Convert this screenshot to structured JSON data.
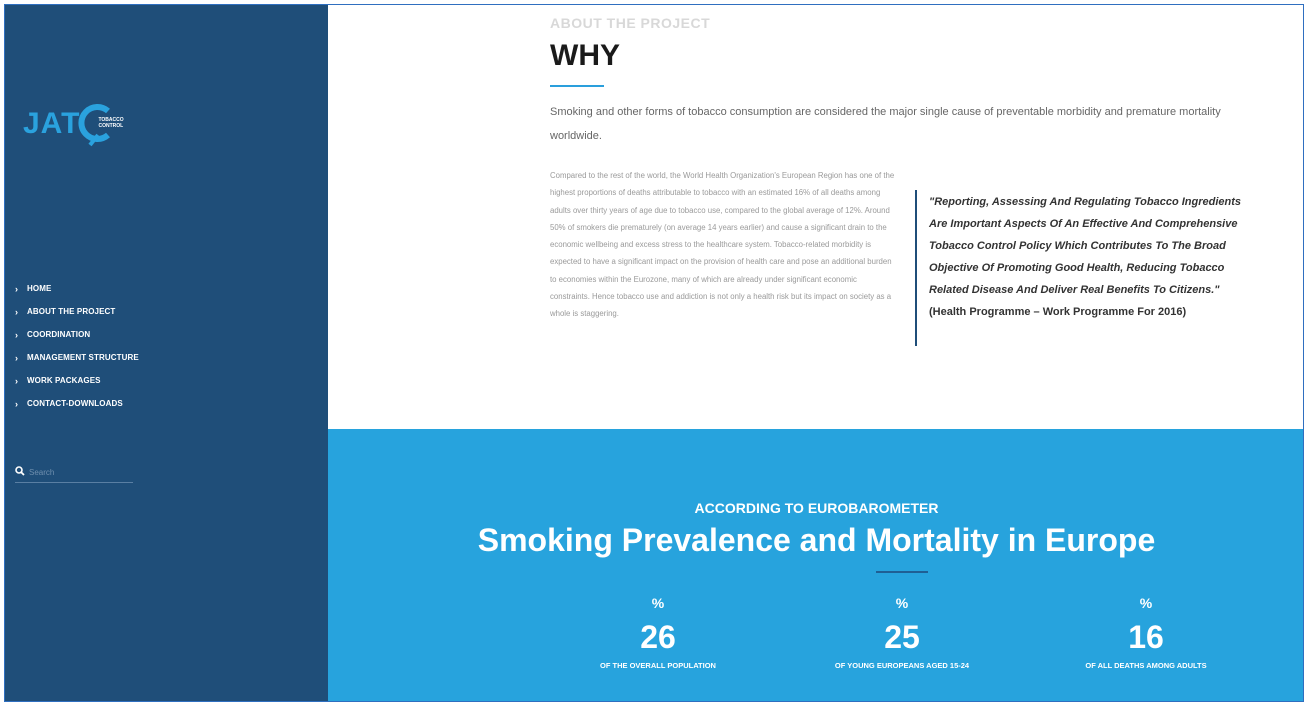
{
  "sidebar": {
    "logo_text": "JAT",
    "logo_sub": "TOBACCO CONTROL",
    "nav": [
      {
        "label": "HOME"
      },
      {
        "label": "ABOUT THE PROJECT"
      },
      {
        "label": "COORDINATION"
      },
      {
        "label": "MANAGEMENT STRUCTURE"
      },
      {
        "label": "WORK PACKAGES"
      },
      {
        "label": "CONTACT-DOWNLOADS"
      }
    ],
    "search_placeholder": "Search"
  },
  "about": {
    "eyebrow": "ABOUT THE PROJECT",
    "title": "WHY",
    "lead": "Smoking and other forms of tobacco consumption are considered the major single cause of preventable morbidity and premature mortality worldwide.",
    "body": "Compared to the rest of the world, the World Health Organization's European Region has one of the highest proportions of deaths attributable to tobacco with an estimated 16% of all deaths among adults over thirty years of age due to tobacco use, compared to the global average of 12%. Around 50% of smokers die prematurely (on average 14 years earlier) and cause a significant drain to the economic wellbeing and excess stress to the healthcare system. Tobacco-related morbidity is expected to have a significant impact on the provision of health care and pose an additional burden to economies within the Eurozone, many of which are already under significant economic constraints. Hence tobacco use and addiction is not only a health risk but its impact on society as a whole is staggering.",
    "quote": "\"Reporting, Assessing And Regulating Tobacco Ingredients Are Important Aspects Of An Effective And Comprehensive Tobacco Control Policy Which Contributes To The Broad Objective Of Promoting Good Health, Reducing Tobacco Related Disease And Deliver Real Benefits To Citizens.\"",
    "quote_source": "(Health Programme – Work Programme For 2016)"
  },
  "stats": {
    "eyebrow": "ACCORDING TO EUROBAROMETER",
    "title": "Smoking Prevalence and Mortality in Europe",
    "items": [
      {
        "pct": "%",
        "value": "26",
        "label": "OF THE OVERALL POPULATION"
      },
      {
        "pct": "%",
        "value": "25",
        "label": "OF YOUNG EUROPEANS AGED 15-24"
      },
      {
        "pct": "%",
        "value": "16",
        "label": "OF ALL DEATHS AMONG ADULTS"
      }
    ]
  },
  "colors": {
    "sidebar": "#1f4e79",
    "accent": "#27a3dd"
  }
}
